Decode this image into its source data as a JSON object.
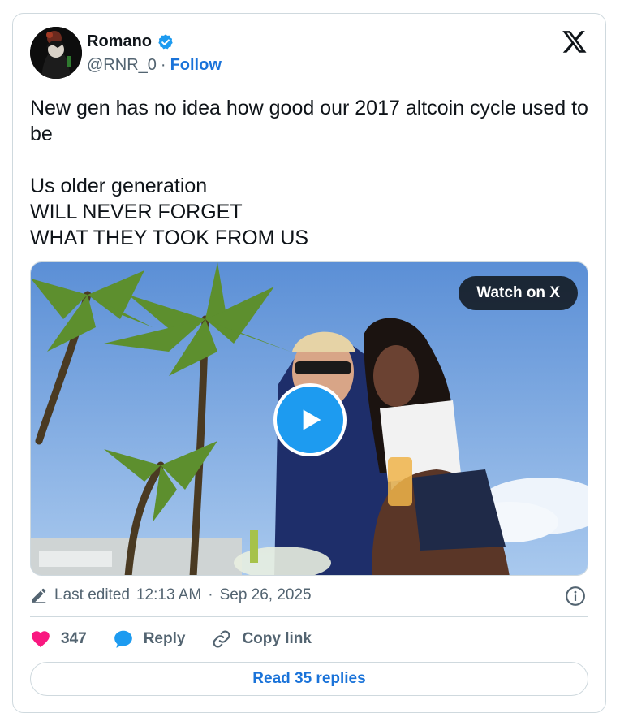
{
  "author": {
    "display_name": "Romano",
    "handle": "@RNR_0",
    "separator": "·",
    "follow_label": "Follow",
    "verified": true
  },
  "tweet": {
    "text": "New gen has no idea how good our 2017 altcoin cycle used to be\n\nUs older generation\nWILL NEVER FORGET\nWHAT THEY TOOK FROM US"
  },
  "media": {
    "type": "video",
    "watch_label": "Watch on X",
    "icons": [
      "play-icon"
    ]
  },
  "meta": {
    "edited_label": "Last edited",
    "time": "12:13 AM",
    "separator": "·",
    "date": "Sep 26, 2025"
  },
  "actions": {
    "likes_count": "347",
    "reply_label": "Reply",
    "copy_label": "Copy link"
  },
  "footer": {
    "read_replies_label": "Read 35 replies"
  },
  "colors": {
    "accent": "#1d9bf0",
    "link": "#1a73d9",
    "like": "#f91880",
    "muted": "#536471",
    "border": "#cfd9de"
  }
}
